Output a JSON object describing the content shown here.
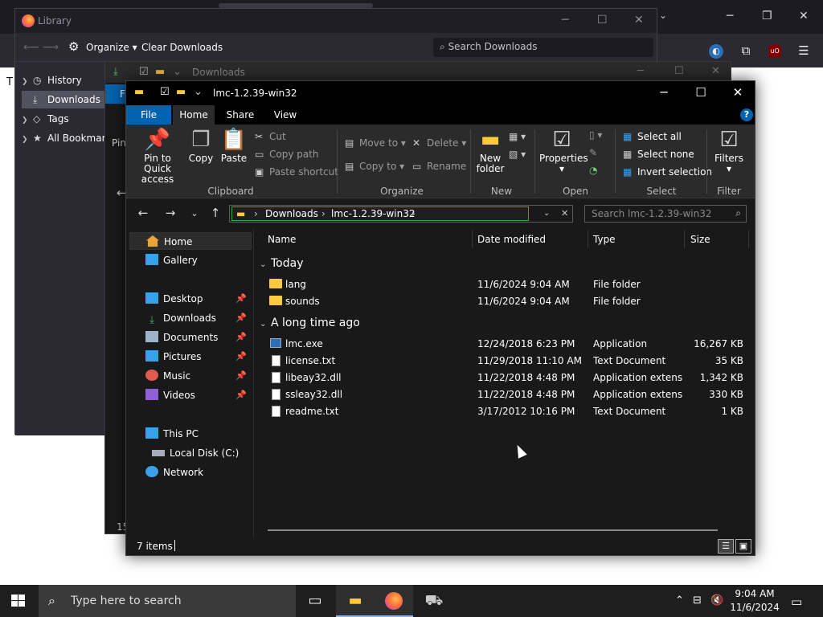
{
  "firefox": {
    "content_letter": "T"
  },
  "library": {
    "title": "Library",
    "toolbar": {
      "organize": "Organize",
      "clear": "Clear Downloads",
      "search_placeholder": "Search Downloads"
    },
    "sidebar": [
      {
        "label": "History",
        "expander": ">"
      },
      {
        "label": "Downloads",
        "expander": ""
      },
      {
        "label": "Tags",
        "expander": ">"
      },
      {
        "label": "All Bookmarks",
        "expander": ">"
      }
    ]
  },
  "mid_explorer": {
    "title": "Downloads",
    "tab_letter": "F",
    "fragment_pin": "Pin",
    "fragment_count": "15"
  },
  "explorer": {
    "title": "lmc-1.2.39-win32",
    "tabs": {
      "file": "File",
      "home": "Home",
      "share": "Share",
      "view": "View"
    },
    "ribbon": {
      "pin_quick": "Pin to Quick access",
      "copy": "Copy",
      "paste": "Paste",
      "cut": "Cut",
      "copy_path": "Copy path",
      "paste_shortcut": "Paste shortcut",
      "move_to": "Move to",
      "copy_to": "Copy to",
      "delete": "Delete",
      "rename": "Rename",
      "new_folder": "New folder",
      "properties": "Properties",
      "select_all": "Select all",
      "select_none": "Select none",
      "invert_selection": "Invert selection",
      "filters": "Filters",
      "groups": {
        "clipboard": "Clipboard",
        "organize": "Organize",
        "new": "New",
        "open": "Open",
        "select": "Select",
        "filter": "Filter"
      }
    },
    "address": {
      "part1": "Downloads",
      "part2": "lmc-1.2.39-win32",
      "search_placeholder": "Search lmc-1.2.39-win32"
    },
    "nav": [
      {
        "label": "Home",
        "color": "#e8a33d",
        "pinned": false
      },
      {
        "label": "Gallery",
        "color": "#3aa0e8",
        "pinned": false
      },
      {
        "label": "Desktop",
        "color": "#3aa0e8",
        "pinned": true
      },
      {
        "label": "Downloads",
        "color": "#3dbb6b",
        "pinned": true
      },
      {
        "label": "Documents",
        "color": "#9fb2c8",
        "pinned": true
      },
      {
        "label": "Pictures",
        "color": "#3aa0e8",
        "pinned": true
      },
      {
        "label": "Music",
        "color": "#e05a4f",
        "pinned": true
      },
      {
        "label": "Videos",
        "color": "#8f5fd6",
        "pinned": true
      },
      {
        "label": "This PC",
        "color": "#3aa0e8",
        "pinned": false
      },
      {
        "label": "Local Disk (C:)",
        "color": "#aab",
        "pinned": false
      },
      {
        "label": "Network",
        "color": "#3aa0e8",
        "pinned": false
      }
    ],
    "columns": {
      "name": "Name",
      "date": "Date modified",
      "type": "Type",
      "size": "Size"
    },
    "groups": {
      "today": "Today",
      "long_ago": "A long time ago"
    },
    "files_today": [
      {
        "name": "lang",
        "date": "11/6/2024 9:04 AM",
        "type": "File folder",
        "size": "",
        "icon": "folder"
      },
      {
        "name": "sounds",
        "date": "11/6/2024 9:04 AM",
        "type": "File folder",
        "size": "",
        "icon": "folder"
      }
    ],
    "files_old": [
      {
        "name": "lmc.exe",
        "date": "12/24/2018 6:23 PM",
        "type": "Application",
        "size": "16,267 KB",
        "icon": "exe"
      },
      {
        "name": "license.txt",
        "date": "11/29/2018 11:10 AM",
        "type": "Text Document",
        "size": "35 KB",
        "icon": "doc"
      },
      {
        "name": "libeay32.dll",
        "date": "11/22/2018 4:48 PM",
        "type": "Application extens...",
        "size": "1,342 KB",
        "icon": "doc"
      },
      {
        "name": "ssleay32.dll",
        "date": "11/22/2018 4:48 PM",
        "type": "Application extens...",
        "size": "330 KB",
        "icon": "doc"
      },
      {
        "name": "readme.txt",
        "date": "3/17/2012 10:16 PM",
        "type": "Text Document",
        "size": "1 KB",
        "icon": "doc"
      }
    ],
    "status": "7 items"
  },
  "taskbar": {
    "search_placeholder": "Type here to search",
    "time": "9:04 AM",
    "date": "11/6/2024"
  }
}
